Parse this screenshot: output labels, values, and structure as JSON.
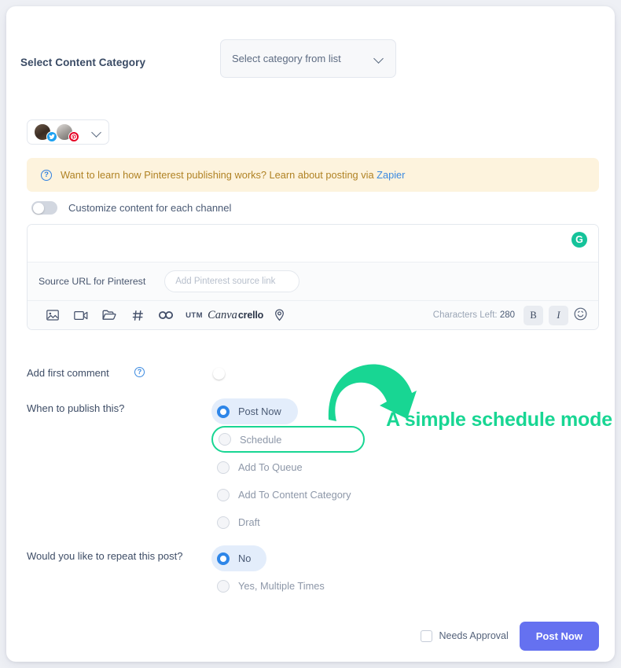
{
  "category": {
    "label": "Select Content Category",
    "select_value": "Select category from list",
    "chevron_icon": "chevron-down-icon"
  },
  "accounts": {
    "items": [
      {
        "network": "twitter",
        "badge_glyph": "t"
      },
      {
        "network": "pinterest",
        "badge_glyph": "P"
      }
    ],
    "chevron_icon": "chevron-down-icon"
  },
  "banner": {
    "icon": "question-circle-icon",
    "text": "Want to learn how Pinterest publishing works? Learn about posting via ",
    "link": "Zapier"
  },
  "customize": {
    "label": "Customize content for each channel",
    "toggle_on": false
  },
  "editor": {
    "grammarly_badge": "G",
    "source_label": "Source URL for Pinterest",
    "source_placeholder": "Add Pinterest source link",
    "toolbar_icons": [
      {
        "name": "image-icon",
        "glyph": ""
      },
      {
        "name": "video-icon",
        "glyph": ""
      },
      {
        "name": "folder-icon",
        "glyph": ""
      },
      {
        "name": "hashtag-icon",
        "glyph": "#"
      },
      {
        "name": "link-icon",
        "glyph": ""
      },
      {
        "name": "utm-icon",
        "glyph": "UTM"
      },
      {
        "name": "canva-icon",
        "glyph": "Canva"
      },
      {
        "name": "crello-icon",
        "glyph": "crello"
      },
      {
        "name": "location-pin-icon",
        "glyph": ""
      }
    ],
    "characters_left_label": "Characters Left:",
    "characters_left_value": "280",
    "bold_label": "B",
    "italic_label": "I",
    "emoji_icon": "smiley-icon"
  },
  "first_comment": {
    "label": "Add first comment",
    "help_icon": "question-circle-icon",
    "toggle_on": false
  },
  "publish": {
    "label": "When to publish this?",
    "options": [
      {
        "label": "Post Now",
        "selected": true,
        "highlighted": false
      },
      {
        "label": "Schedule",
        "selected": false,
        "highlighted": true
      },
      {
        "label": "Add To Queue",
        "selected": false,
        "highlighted": false
      },
      {
        "label": "Add To Content Category",
        "selected": false,
        "highlighted": false
      },
      {
        "label": "Draft",
        "selected": false,
        "highlighted": false
      }
    ]
  },
  "repeat": {
    "label": "Would you like to repeat this post?",
    "options": [
      {
        "label": "No",
        "selected": true
      },
      {
        "label": "Yes, Multiple Times",
        "selected": false
      }
    ]
  },
  "footer": {
    "needs_approval_label": "Needs Approval",
    "needs_approval_checked": false,
    "primary_button": "Post Now"
  },
  "annotation": {
    "text": "A simple schedule mode",
    "color": "#18d693",
    "arrow_icon": "curved-arrow-icon"
  },
  "colors": {
    "accent_blue": "#2e86e8",
    "primary_button": "#6571f0",
    "annotation_green": "#18d693",
    "banner_bg": "#fdf3dd",
    "banner_text": "#b08224"
  }
}
